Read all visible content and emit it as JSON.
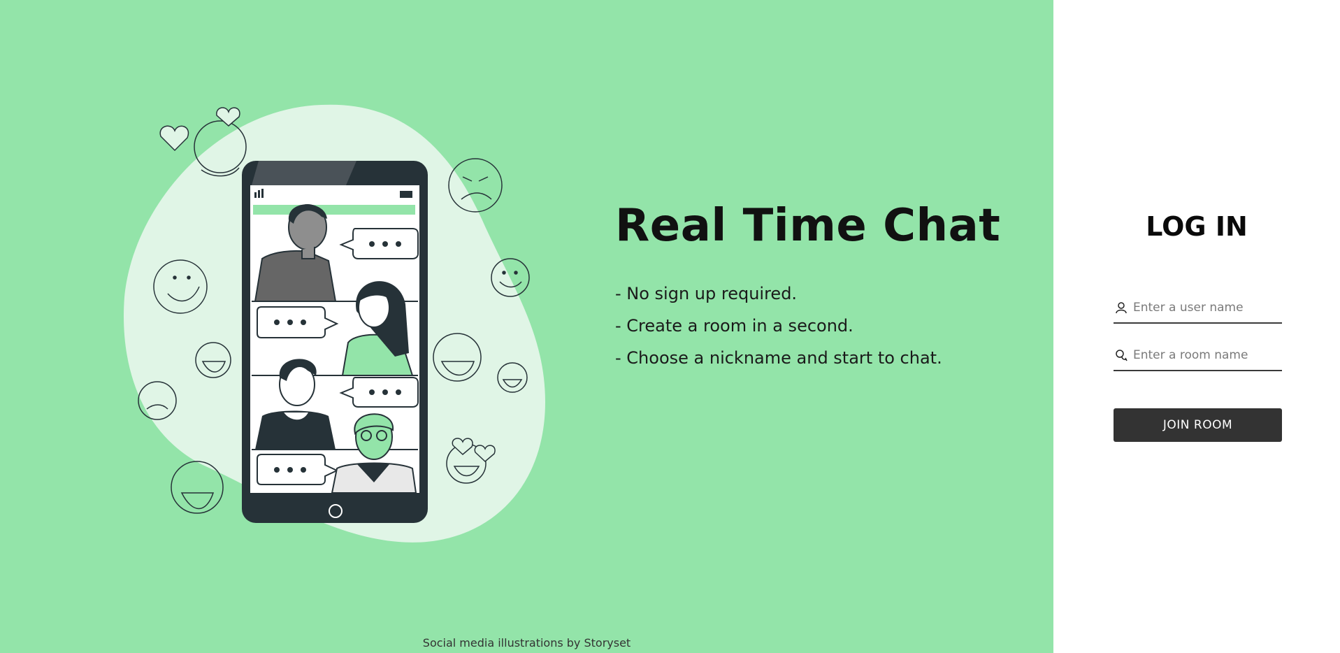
{
  "hero": {
    "title": "Real Time Chat",
    "features": [
      "- No sign up required.",
      "- Create a room in a second.",
      "- Choose a nickname and start to chat."
    ],
    "credit": "Social media illustrations by Storyset"
  },
  "login": {
    "title": "LOG IN",
    "username_placeholder": "Enter a user name",
    "username_value": "",
    "room_placeholder": "Enter a room name",
    "room_value": "",
    "join_label": "JOIN ROOM",
    "username_icon": "user-icon",
    "room_icon": "chat-bubbles-icon"
  },
  "colors": {
    "left_background": "#93e4a9",
    "right_background": "#ffffff",
    "blob": "#e0f5e6",
    "accent_green": "#93e4a9",
    "button": "#333333",
    "outline": "#263238"
  }
}
